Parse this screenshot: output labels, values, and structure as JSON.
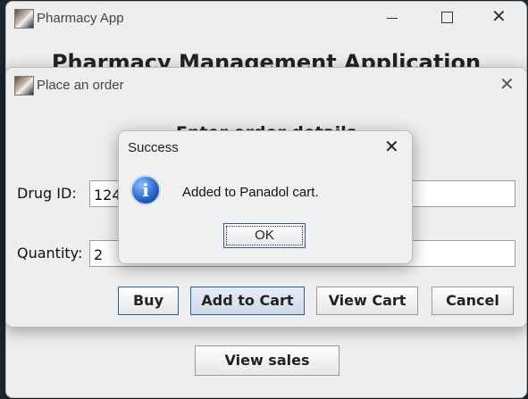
{
  "main_window": {
    "title": "Pharmacy App",
    "heading": "Pharmacy Management Application",
    "view_sales_label": "View sales"
  },
  "order_dialog": {
    "title": "Place an order",
    "heading": "Enter order details",
    "drug_id_label": "Drug ID:",
    "drug_id_value": "124",
    "quantity_label": "Quantity:",
    "quantity_value": "2",
    "buy_label": "Buy",
    "add_to_cart_label": "Add to Cart",
    "view_cart_label": "View Cart",
    "cancel_label": "Cancel"
  },
  "message_dialog": {
    "title": "Success",
    "message": "Added to Panadol cart.",
    "ok_label": "OK"
  },
  "icons": {
    "minimize": "minimize-icon",
    "maximize": "maximize-icon",
    "close": "close-icon",
    "info": "info-icon",
    "app": "app-icon"
  },
  "colors": {
    "window_bg": "#eeeeee",
    "focus_border": "#2f5f8f",
    "info_blue": "#1f63c6",
    "desktop_bg": "#1f2a33"
  }
}
